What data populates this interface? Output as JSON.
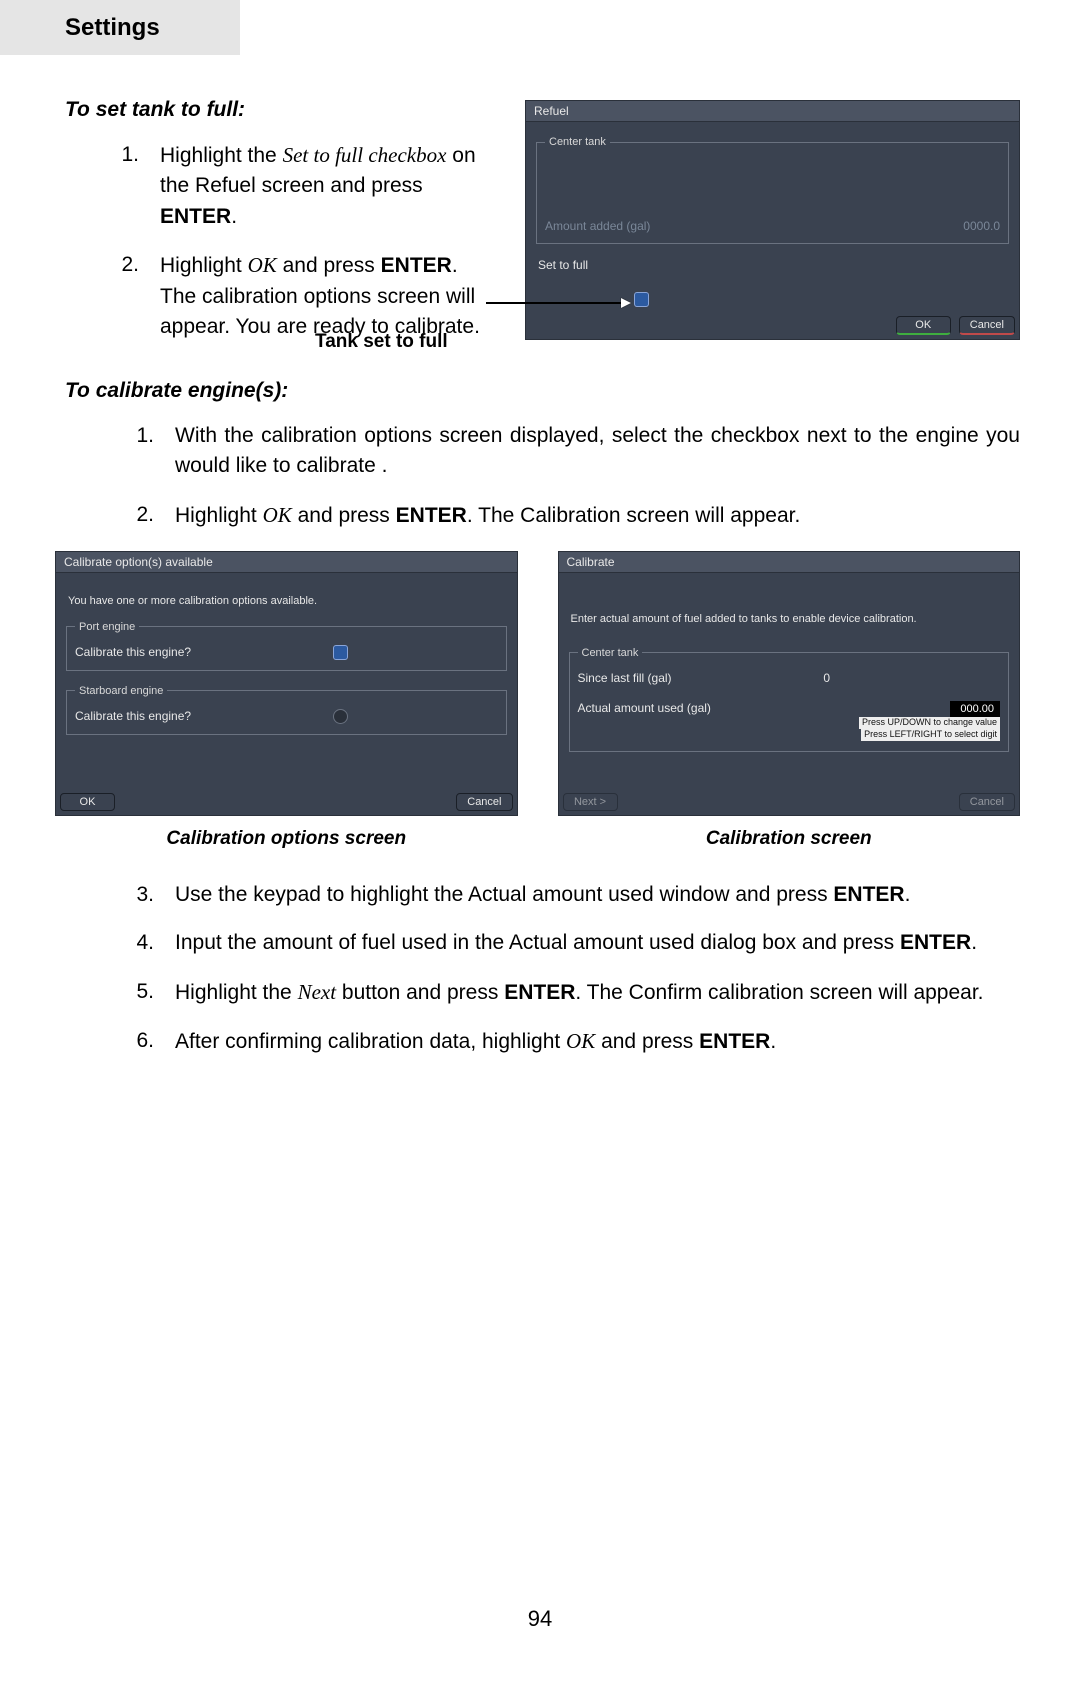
{
  "header": {
    "title": "Settings"
  },
  "page_number": "94",
  "section1": {
    "heading": "To set tank to full:",
    "items": [
      {
        "num": "1.",
        "parts": [
          "Highlight the ",
          "Set to full checkbox",
          " on the Refuel screen and press ",
          "ENTER",
          "."
        ]
      },
      {
        "num": "2.",
        "parts": [
          "Highlight ",
          "OK",
          " and press ",
          "ENTER",
          ". The calibration options screen will appear. You are ready to calibrate."
        ]
      }
    ],
    "callout": "Tank set to full"
  },
  "refuel_panel": {
    "title": "Refuel",
    "fieldset": "Center tank",
    "amount_label": "Amount added (gal)",
    "amount_value": "0000.0",
    "set_to_full_label": "Set to full",
    "ok": "OK",
    "cancel": "Cancel"
  },
  "section2": {
    "heading": "To calibrate engine(s):",
    "items_a": [
      {
        "num": "1.",
        "text": "With the calibration options screen displayed, select the checkbox next to the engine you would like to calibrate ."
      },
      {
        "num": "2.",
        "parts": [
          "Highlight ",
          "OK",
          " and press ",
          "ENTER",
          ". The Calibration screen will appear."
        ]
      }
    ],
    "items_b": [
      {
        "num": "3.",
        "parts": [
          "Use the keypad to highlight the Actual amount used window and press ",
          "ENTER",
          "."
        ]
      },
      {
        "num": "4.",
        "parts": [
          "Input the amount of fuel used in the Actual amount used dialog box and press ",
          "ENTER",
          "."
        ]
      },
      {
        "num": "5.",
        "parts": [
          "Highlight the ",
          "Next",
          " button and press ",
          "ENTER",
          ". The Confirm calibration screen will appear."
        ]
      },
      {
        "num": "6.",
        "parts": [
          "After confirming calibration data, highlight ",
          "OK",
          " and press ",
          "ENTER",
          "."
        ]
      }
    ]
  },
  "options_panel": {
    "title": "Calibrate option(s) available",
    "intro": "You have one or more calibration options available.",
    "port_legend": "Port engine",
    "calibrate_label": "Calibrate this engine?",
    "starboard_legend": "Starboard engine",
    "ok": "OK",
    "cancel": "Cancel",
    "caption": "Calibration options screen"
  },
  "calibrate_panel": {
    "title": "Calibrate",
    "intro": "Enter actual amount of fuel added to tanks to enable device calibration.",
    "tank_legend": "Center tank",
    "since_label": "Since last fill (gal)",
    "since_value": "0",
    "actual_label": "Actual amount used (gal)",
    "actual_value": "000.00",
    "hint1": "Press UP/DOWN to change value",
    "hint2": "Press LEFT/RIGHT to select digit",
    "next": "Next >",
    "cancel": "Cancel",
    "caption": "Calibration screen"
  }
}
